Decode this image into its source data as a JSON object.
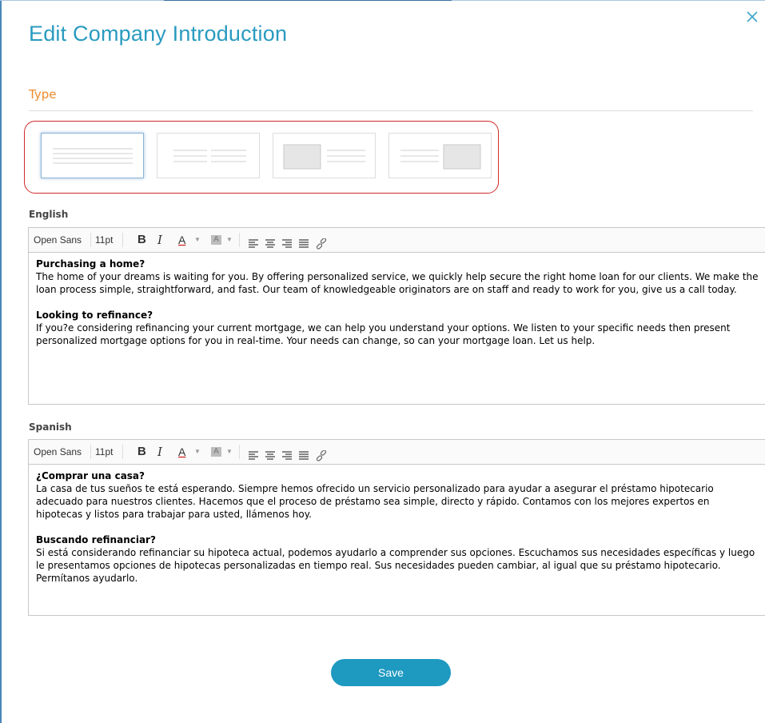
{
  "dialog": {
    "title": "Edit Company Introduction",
    "close_icon": "close-icon"
  },
  "type_section": {
    "label": "Type",
    "options": [
      {
        "name": "text-full-width",
        "selected": true
      },
      {
        "name": "text-two-columns",
        "selected": false
      },
      {
        "name": "image-left-text-right",
        "selected": false
      },
      {
        "name": "text-left-image-right",
        "selected": false
      }
    ]
  },
  "english": {
    "label": "English",
    "toolbar": {
      "font": "Open Sans",
      "size": "11pt",
      "bold": "B",
      "italic": "I",
      "text_color": "A",
      "bg_color": "A"
    },
    "heading1": "Purchasing a home?",
    "para1": "The home of your dreams is waiting for you. By offering personalized service, we quickly help secure the right home loan for our clients. We make the loan process simple, straightforward, and fast. Our team of knowledgeable originators are on staff and ready to work for you, give us a call today.",
    "heading2": "Looking to refinance?",
    "para2": "If you?e considering refinancing your current mortgage, we can help you understand your options. We listen to your specific needs then present personalized mortgage options for you in real-time. Your needs can change, so can your mortgage loan. Let us help."
  },
  "spanish": {
    "label": "Spanish",
    "toolbar": {
      "font": "Open Sans",
      "size": "11pt",
      "bold": "B",
      "italic": "I",
      "text_color": "A",
      "bg_color": "A"
    },
    "heading1": "¿Comprar una casa?",
    "para1": "La casa de tus sueños te está esperando. Siempre hemos ofrecido un servicio personalizado para ayudar a asegurar el préstamo hipotecario adecuado para nuestros clientes. Hacemos que el proceso de préstamo sea simple, directo y rápido. Contamos con los mejores expertos en hipotecas y listos para trabajar para usted, llámenos hoy.",
    "heading2": "Buscando refinanciar?",
    "para2": "Si está considerando refinanciar su hipoteca actual, podemos ayudarlo a comprender sus opciones. Escuchamos sus necesidades específicas y luego le presentamos opciones de hipotecas personalizadas en tiempo real. Sus necesidades pueden cambiar, al igual que su préstamo hipotecario. Permítanos ayudarlo."
  },
  "save_label": "Save",
  "colors": {
    "accent": "#2a9bc0",
    "section_label": "#ef8a2b",
    "highlight_border": "#d22b2b",
    "button": "#1e99c0"
  }
}
